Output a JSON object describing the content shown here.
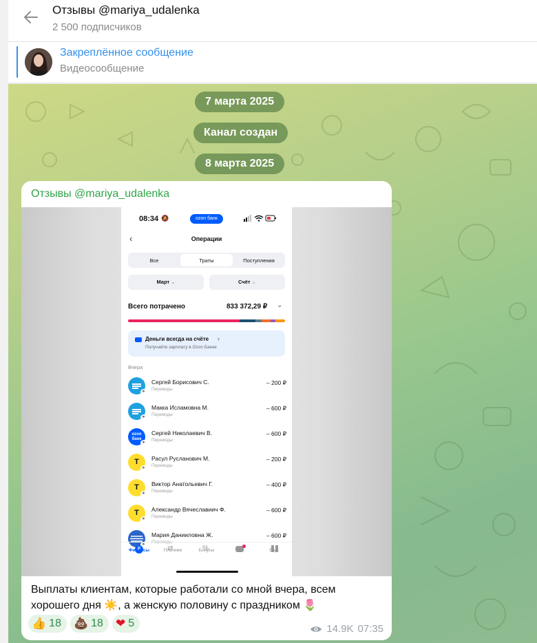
{
  "header": {
    "title": "Отзывы @mariya_udalenka",
    "subscribers": "2 500 подписчиков"
  },
  "pinned": {
    "title": "Закреплённое сообщение",
    "subtitle": "Видеосообщение"
  },
  "service": {
    "date1": "7 марта 2025",
    "created": "Канал создан",
    "date2": "8 марта 2025"
  },
  "message": {
    "author": "Отзывы @mariya_udalenka",
    "text_part1": "Выплаты клиентам, которые работали со мной вчера, всем хорошего дня ",
    "text_part2": ", а женскую половину с праздником ",
    "reactions": [
      {
        "emoji": "👍",
        "count": "18"
      },
      {
        "emoji": "💩",
        "count": "18"
      },
      {
        "emoji": "❤",
        "count": "5"
      }
    ],
    "views": "14.9K",
    "time": "07:35"
  },
  "screenshot": {
    "time": "08:34",
    "bank_badge": "ozon банк",
    "screen_title": "Операции",
    "tabs": [
      "Все",
      "Траты",
      "Поступления"
    ],
    "filter_month": "Март",
    "filter_account": "Счёт",
    "total_label": "Всего потрачено",
    "total_value": "833 372,29 ₽",
    "banner_title": "Деньги всегда на счёте",
    "banner_sub": "Получайте зарплату в Ozon Банке",
    "section": "Вчера",
    "operations": [
      {
        "name": "Сергей Борисович С.",
        "category": "Переводы",
        "amount": "– 200 ₽",
        "bank": "sber"
      },
      {
        "name": "Макка Исламовна М.",
        "category": "Переводы",
        "amount": "– 600 ₽",
        "bank": "sber"
      },
      {
        "name": "Сергей Николаевич В.",
        "category": "Переводы",
        "amount": "– 600 ₽",
        "bank": "ozon"
      },
      {
        "name": "Расул Русланович М.",
        "category": "Переводы",
        "amount": "– 200 ₽",
        "bank": "tbank"
      },
      {
        "name": "Виктор Анатольевич Г.",
        "category": "Переводы",
        "amount": "– 400 ₽",
        "bank": "tbank"
      },
      {
        "name": "Александр Вячеславиич Ф.",
        "category": "Переводы",
        "amount": "– 600 ₽",
        "bank": "tbank"
      },
      {
        "name": "Мария Данииловна Ж.",
        "category": "Переводы",
        "amount": "– 600 ₽",
        "bank": "vtb"
      }
    ],
    "nav": [
      "Финансы",
      "Платежи",
      "Бонусы",
      "Чат",
      "Ещё"
    ],
    "colors": {
      "sber": "#21a038",
      "ozon": "#005bff",
      "tbank": "#ffdd2d",
      "vtb": "#0a2896",
      "accent": "#005bff"
    }
  }
}
